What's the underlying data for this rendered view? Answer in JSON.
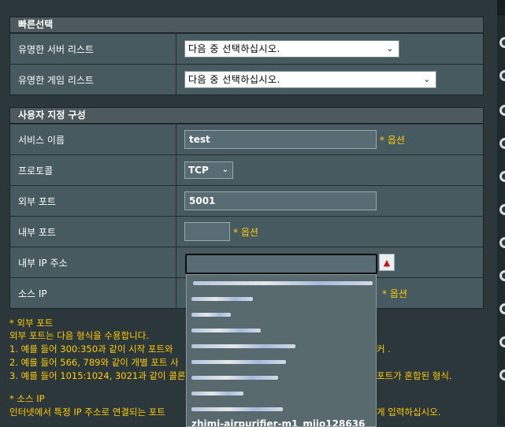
{
  "quick": {
    "title": "빠른선택",
    "server_label": "유명한 서버 리스트",
    "server_value": "다음 중 선택하십시오.",
    "game_label": "유명한 게임 리스트",
    "game_value": "다음 중 선택하십시오."
  },
  "custom": {
    "title": "사용자 지정 구성",
    "service_label": "서비스 이름",
    "service_value": "test",
    "protocol_label": "프로토콜",
    "protocol_value": "TCP",
    "ext_port_label": "외부 포트",
    "ext_port_value": "5001",
    "int_port_label": "내부 포트",
    "int_port_value": "",
    "int_ip_label": "내부 IP 주소",
    "int_ip_value": "",
    "source_ip_label": "소스 IP",
    "optional": "* 옵션"
  },
  "help": {
    "ext_title": "* 외부 포트",
    "ext_line0": "외부 포트는 다음 형식을 수용합니다.",
    "ext_line1_a": "1. 예를 들어 300:350과 같이 시작 포트와",
    "ext_line1_b": "커 .",
    "ext_line2_a": "2. 예를 들어 566, 789와 같이 개별 포트 사",
    "ext_line3_a": "3. 예를 들어 1015:1024, 3021과 같이 콜론",
    "ext_line3_b": "포트가 혼합된 형식.",
    "src_title": "* 소스 IP",
    "src_line_a": "인터넷에서 특정 IP 주소로 연결되는 포트",
    "src_line_b": "게 입력하십시오."
  },
  "dropdown": {
    "last_item": "zhimi-airpurifier-m1_miio128636"
  },
  "icons": {
    "chevron": "chevron-down-icon",
    "arrow_up": "arrow-up-icon"
  },
  "colors": {
    "background": "#2b373b",
    "panel_row": "#475a5f",
    "header": "#4d595d",
    "accent_yellow": "#ffcc00",
    "arrow_red": "#c01818"
  }
}
